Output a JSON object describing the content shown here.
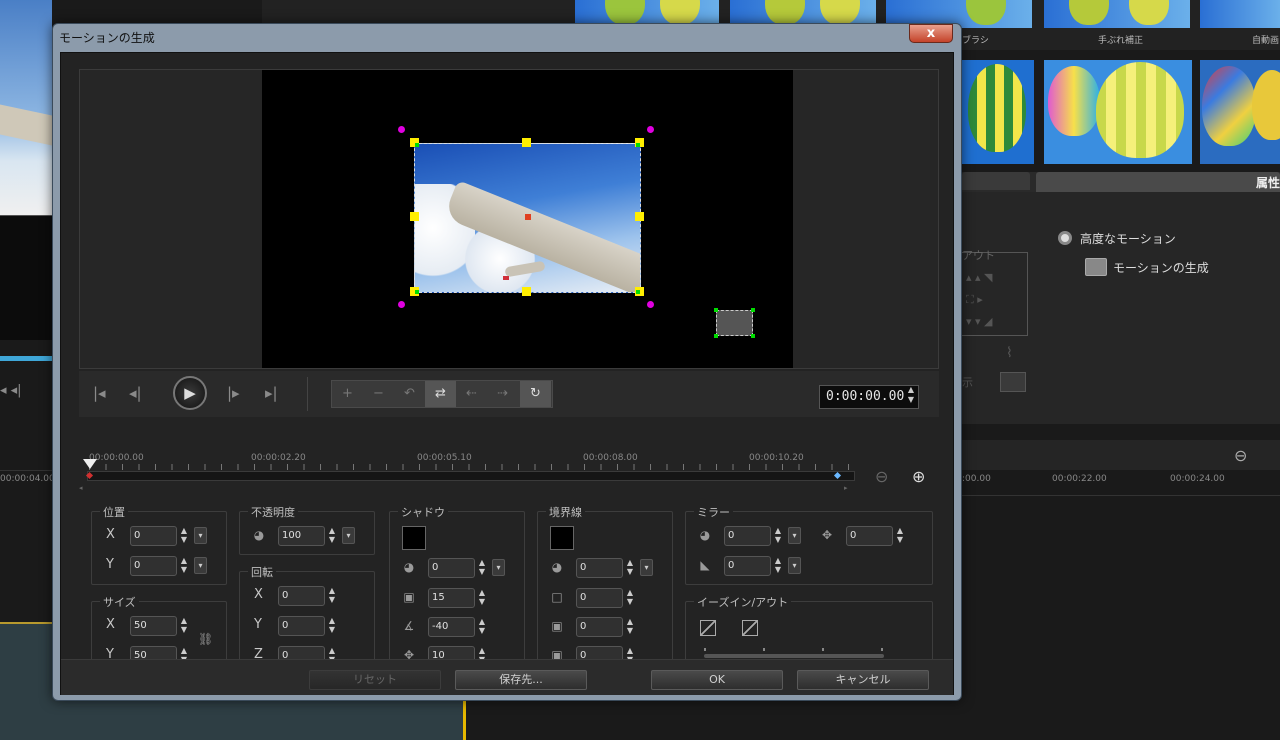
{
  "dialog": {
    "title": "モーションの生成",
    "close_label": "x"
  },
  "background": {
    "thumb_labels": [
      "ブラシ",
      "手ぶれ補正",
      "自動画"
    ],
    "attributes_tab": "属性",
    "advanced_motion_label": "高度なモーション",
    "generate_motion_label": "モーションの生成",
    "timeline_labels": [
      "00:00:04.00",
      ":00.00",
      "00:00:22.00",
      "00:00:24.00"
    ],
    "faded_labels": [
      "アウト",
      "示"
    ]
  },
  "playback": {
    "timecode": "0:00:00.00"
  },
  "timeline": {
    "ticks": [
      "00:00:00.00",
      "00:00:02.20",
      "00:00:05.10",
      "00:00:08.00",
      "00:00:10.20"
    ]
  },
  "position": {
    "title": "位置",
    "x_label": "X",
    "x_value": "0",
    "y_label": "Y",
    "y_value": "0"
  },
  "opacity": {
    "title": "不透明度",
    "value": "100"
  },
  "size": {
    "title": "サイズ",
    "x_label": "X",
    "x_value": "50",
    "y_label": "Y",
    "y_value": "50"
  },
  "rotation": {
    "title": "回転",
    "x_label": "X",
    "x_value": "0",
    "y_label": "Y",
    "y_value": "0",
    "z_label": "Z",
    "z_value": "0"
  },
  "shadow": {
    "title": "シャドウ",
    "opacity_value": "0",
    "blur_value": "15",
    "angle_value": "-40",
    "distance_value": "10"
  },
  "border": {
    "title": "境界線",
    "v1": "0",
    "v2": "0",
    "v3": "0",
    "v4": "0"
  },
  "mirror": {
    "title": "ミラー",
    "opacity_value": "0",
    "distance_value": "0",
    "fade_value": "0"
  },
  "ease": {
    "title": "イーズイン/アウト"
  },
  "buttons": {
    "reset": "リセット",
    "save_as": "保存先...",
    "ok": "OK",
    "cancel": "キャンセル"
  }
}
